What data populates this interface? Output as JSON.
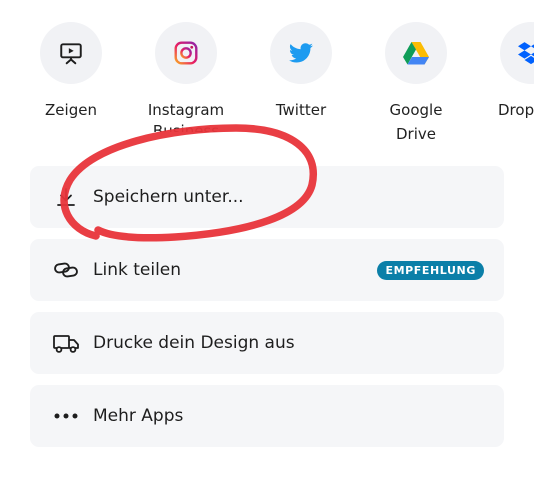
{
  "apps": [
    {
      "label": "Zeigen",
      "icon": "presentation-icon"
    },
    {
      "label": "Instagram",
      "sublabel": "Business",
      "icon": "instagram-icon"
    },
    {
      "label": "Twitter",
      "icon": "twitter-icon"
    },
    {
      "label": "Google\nDrive",
      "icon": "google-drive-icon"
    },
    {
      "label": "Dropbox",
      "icon": "dropbox-icon"
    }
  ],
  "actions": [
    {
      "label": "Speichern unter...",
      "icon": "download-icon"
    },
    {
      "label": "Link teilen",
      "icon": "link-icon",
      "badge": "EMPFEHLUNG"
    },
    {
      "label": "Drucke dein Design aus",
      "icon": "truck-icon"
    },
    {
      "label": "Mehr Apps",
      "icon": "more-dots-icon"
    }
  ],
  "colors": {
    "badge": "#0b7fa8",
    "row_background": "#f5f6f8",
    "circle_background": "#f1f2f5",
    "twitter": "#1d9bf0",
    "dropbox": "#0061fe",
    "annotation": "#e8343a"
  }
}
